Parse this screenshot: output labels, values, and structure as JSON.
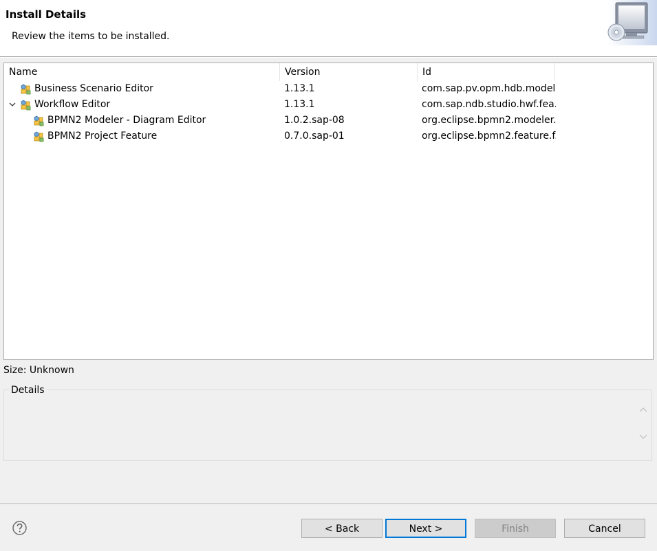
{
  "banner": {
    "title": "Install Details",
    "description": "Review the items to be installed."
  },
  "tree": {
    "columns": [
      "Name",
      "Version",
      "Id"
    ],
    "rows": [
      {
        "name": "Business Scenario Editor",
        "version": "1.13.1",
        "id": "com.sap.pv.opm.hdb.model...",
        "depth": 0,
        "expandable": false
      },
      {
        "name": "Workflow Editor",
        "version": "1.13.1",
        "id": "com.sap.ndb.studio.hwf.fea...",
        "depth": 0,
        "expandable": true,
        "expanded": true
      },
      {
        "name": "BPMN2 Modeler - Diagram Editor",
        "version": "1.0.2.sap-08",
        "id": "org.eclipse.bpmn2.modeler...",
        "depth": 1,
        "expandable": false
      },
      {
        "name": "BPMN2 Project Feature",
        "version": "0.7.0.sap-01",
        "id": "org.eclipse.bpmn2.feature.f...",
        "depth": 1,
        "expandable": false
      }
    ]
  },
  "size": {
    "text": "Size: Unknown"
  },
  "details": {
    "legend": "Details",
    "content": ""
  },
  "buttons": {
    "back": "< Back",
    "next": "Next >",
    "finish": "Finish",
    "cancel": "Cancel"
  },
  "icons": {
    "help": "help-icon",
    "banner": "install-computer-cd-icon",
    "feature": "feature-plugin-icon",
    "expand": "chevron-down-icon"
  },
  "colors": {
    "focus_border": "#0078d7",
    "button_bg": "#e1e1e1",
    "disabled_text": "#838383"
  }
}
